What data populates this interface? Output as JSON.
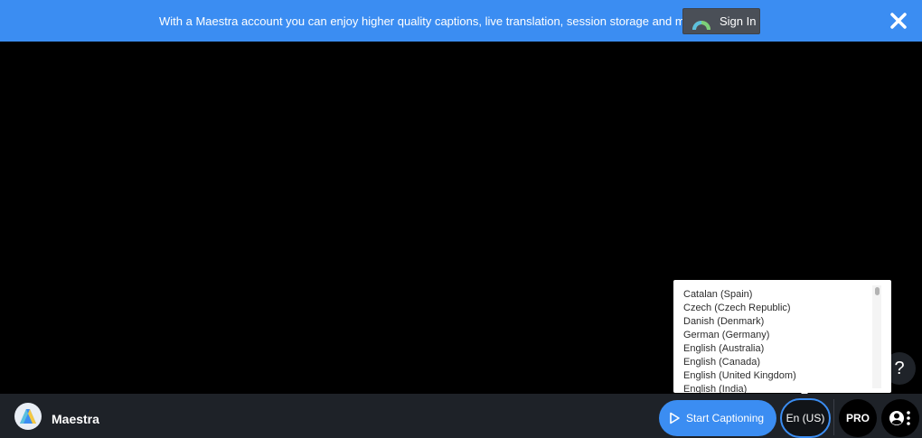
{
  "banner": {
    "message": "With a Maestra account you can enjoy higher quality captions, live translation, session storage and more!",
    "signin_label": "Sign In",
    "close_icon": "close-icon"
  },
  "language_dropdown": {
    "items": [
      "Catalan (Spain)",
      "Czech (Czech Republic)",
      "Danish (Denmark)",
      "German (Germany)",
      "English (Australia)",
      "English (Canada)",
      "English (United Kingdom)",
      "English (India)"
    ]
  },
  "help": {
    "label": "?"
  },
  "bottom_bar": {
    "app_name": "Maestra",
    "start_label": "Start Captioning",
    "language_label": "En (US)",
    "pro_label": "PRO"
  },
  "colors": {
    "accent": "#3b8df2",
    "bar": "#1e2228",
    "signin_bg": "#4a4f57"
  }
}
